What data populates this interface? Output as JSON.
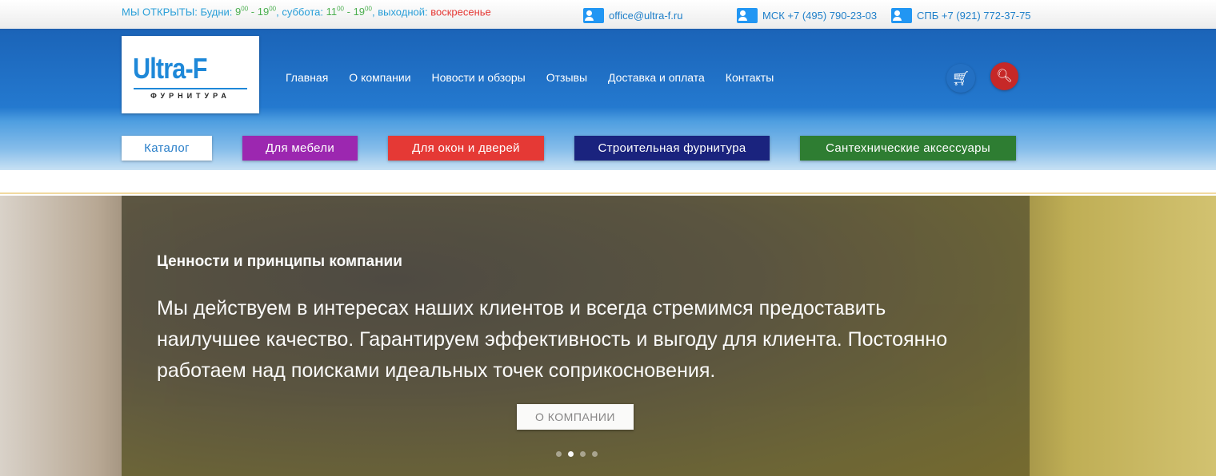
{
  "topbar": {
    "open_label": "МЫ ОТКРЫТЫ:",
    "weekdays_label": "Будни:",
    "weekdays_from": "9",
    "weekdays_from_sup": "00",
    "weekdays_to": "19",
    "weekdays_to_sup": "00",
    "saturday_label": "суббота:",
    "saturday_from": "11",
    "saturday_from_sup": "00",
    "saturday_to": "19",
    "saturday_to_sup": "00",
    "dayoff_label": "выходной:",
    "dayoff_value": "воскресенье",
    "email": "office@ultra-f.ru",
    "phone_msk": "МСК +7 (495) 790-23-03",
    "phone_spb": "СПБ +7 (921) 772-37-75"
  },
  "logo": {
    "title": "Ultra-F",
    "subtitle": "ФУРНИТУРА"
  },
  "nav": [
    "Главная",
    "О компании",
    "Новости и обзоры",
    "Отзывы",
    "Доставка и оплата",
    "Контакты"
  ],
  "categories": [
    {
      "label": "Каталог",
      "color": "#ffffff"
    },
    {
      "label": "Для мебели",
      "color": "#9c27b0"
    },
    {
      "label": "Для окон и дверей",
      "color": "#e53935"
    },
    {
      "label": "Строительная фурнитура",
      "color": "#1a237e"
    },
    {
      "label": "Сантехнические аксессуары",
      "color": "#2e7d32"
    }
  ],
  "hero": {
    "title": "Ценности и принципы компании",
    "text": "Мы действуем в интересах наших клиентов и всегда стремимся предоставить наилучшее качество. Гарантируем эффективность и выгоду для клиента. Постоянно работаем над поисками идеальных точек соприкосновения.",
    "button": "О КОМПАНИИ",
    "slides": 4,
    "active_slide": 2
  }
}
